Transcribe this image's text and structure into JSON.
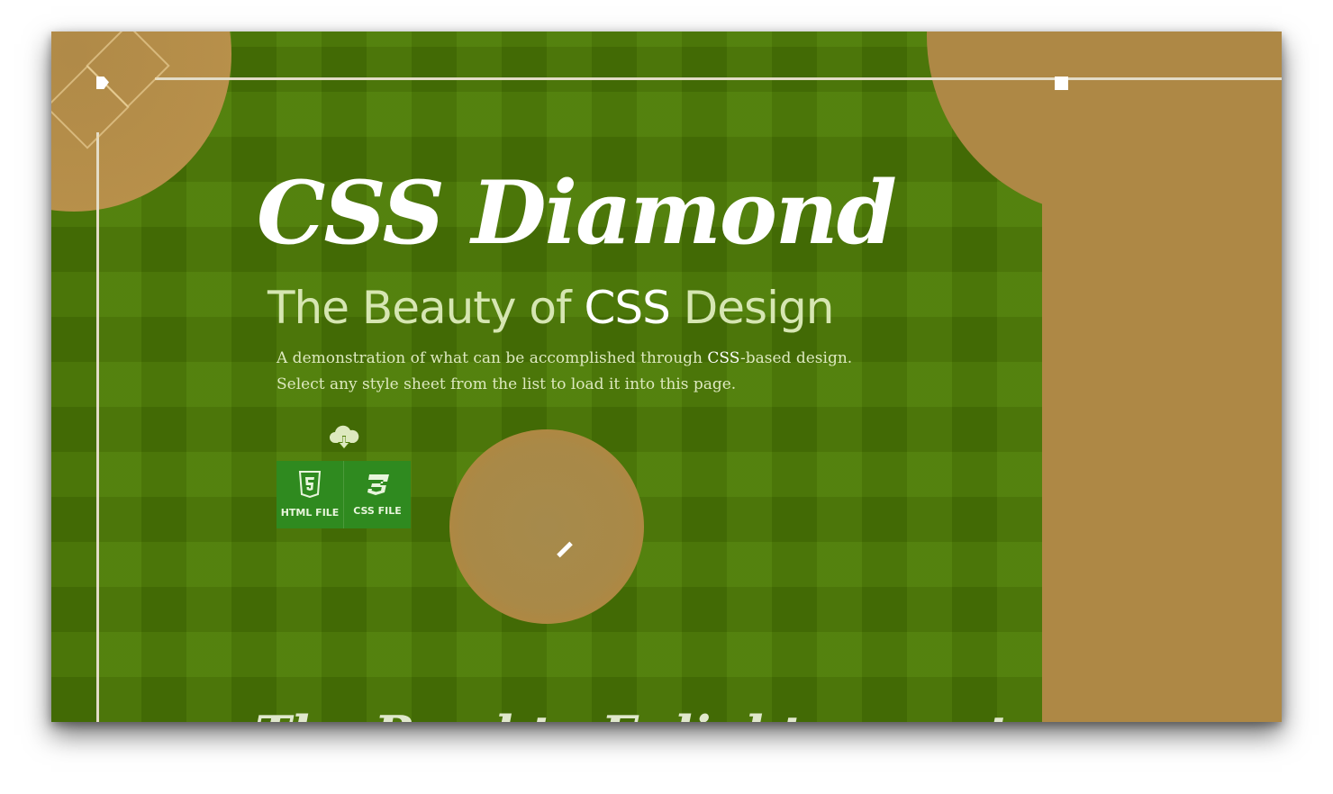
{
  "header": {
    "title": "CSS Diamond",
    "subtitle_pre": "The Beauty of ",
    "subtitle_highlight": "CSS",
    "subtitle_post": " Design"
  },
  "intro": {
    "line1_pre": "A demonstration of what can be accomplished through ",
    "line1_highlight": "CSS",
    "line1_post": "-based design.",
    "line2": "Select any style sheet from the list to load it into this page."
  },
  "downloads": {
    "icon": "cloud-download-icon",
    "html_label": "HTML FILE",
    "html_icon": "html5-icon",
    "css_label": "CSS FILE",
    "css_icon": "css3-icon"
  },
  "next_section": {
    "heading": "The Road to Enlightenment"
  },
  "colors": {
    "grass": "#4e7d05",
    "dirt": "#ae8845",
    "chalk": "#e3dcc7",
    "button": "#2f8a1f"
  }
}
